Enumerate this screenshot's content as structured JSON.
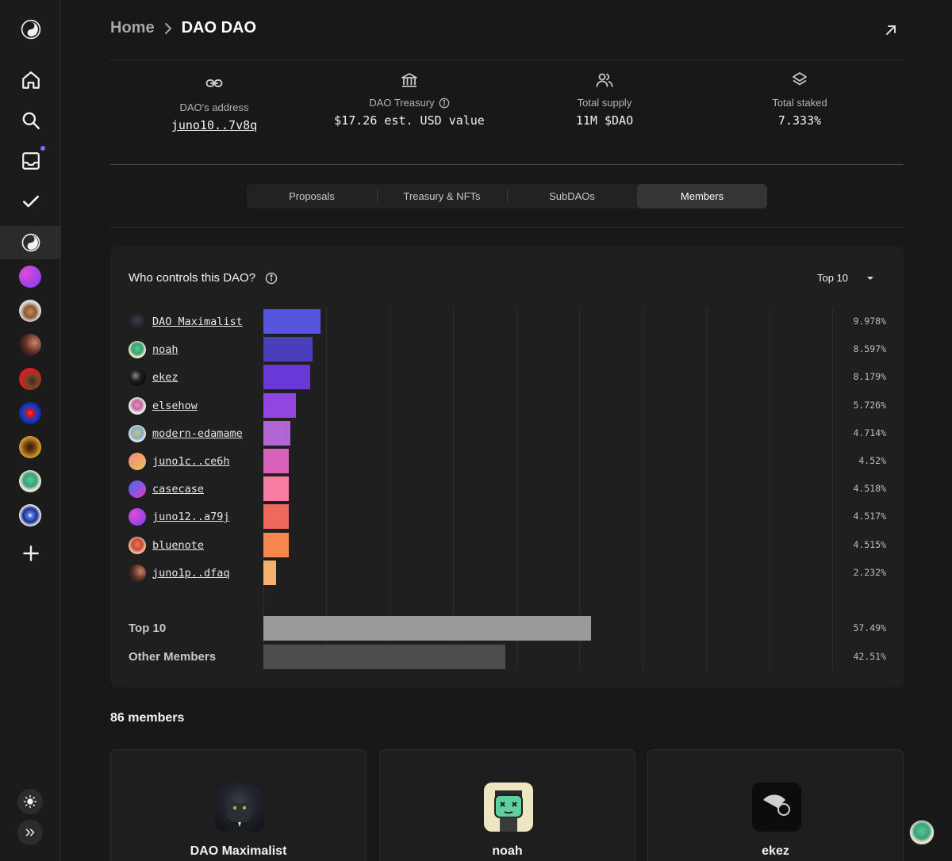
{
  "breadcrumb": {
    "home": "Home",
    "current": "DAO DAO"
  },
  "stats": [
    {
      "icon": "link-icon",
      "label": "DAO's address",
      "value": "juno10..7v8q"
    },
    {
      "icon": "bank-icon",
      "label": "DAO Treasury",
      "value": "$17.26 est. USD value"
    },
    {
      "icon": "users-icon",
      "label": "Total supply",
      "value": "11M $DAO"
    },
    {
      "icon": "layers-icon",
      "label": "Total staked",
      "value": "7.333%"
    }
  ],
  "tabs": [
    "Proposals",
    "Treasury & NFTs",
    "SubDAOs",
    "Members"
  ],
  "active_tab": "Members",
  "card": {
    "title": "Who controls this DAO?",
    "dropdown": "Top 10"
  },
  "chart_data": {
    "type": "bar",
    "orientation": "horizontal",
    "title": "Who controls this DAO?",
    "categories": [
      "DAO Maximalist",
      "noah",
      "ekez",
      "elsehow",
      "modern-edamame",
      "juno1c..ce6h",
      "casecase",
      "juno12..a79j",
      "bluenote",
      "juno1p..dfaq"
    ],
    "values": [
      9.978,
      8.597,
      8.179,
      5.726,
      4.714,
      4.52,
      4.518,
      4.517,
      4.515,
      2.232
    ],
    "labels": [
      "9.978%",
      "8.597%",
      "8.179%",
      "5.726%",
      "4.714%",
      "4.52%",
      "4.518%",
      "4.517%",
      "4.515%",
      "2.232%"
    ],
    "colors": [
      "#5655de",
      "#4a3ebd",
      "#6a38d6",
      "#9146e2",
      "#b266d6",
      "#d861bc",
      "#f97da3",
      "#ef6a5c",
      "#f5874f",
      "#f8b06e"
    ],
    "summary": [
      {
        "name": "Top 10",
        "value": 57.49,
        "label": "57.49%",
        "color": "#9a9a9a"
      },
      {
        "name": "Other Members",
        "value": 42.51,
        "label": "42.51%",
        "color": "#4d4d4d"
      }
    ],
    "xlim": [
      0,
      73.5
    ],
    "grid": true
  },
  "members": {
    "count_label": "86 members",
    "cards": [
      "DAO Maximalist",
      "noah",
      "ekez"
    ]
  }
}
